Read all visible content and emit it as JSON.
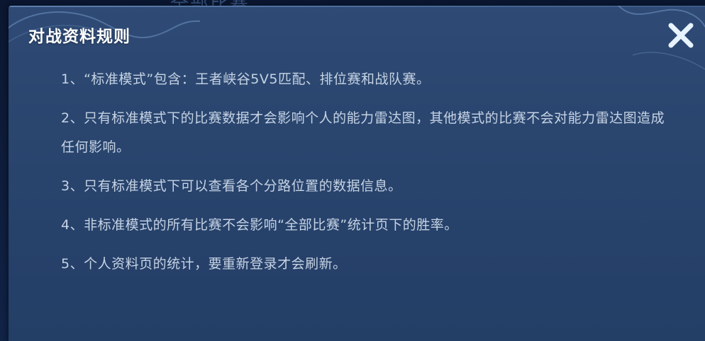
{
  "background": {
    "partial_text": "全部比赛"
  },
  "dialog": {
    "title": "对战资料规则",
    "close_icon": "close-x-icon",
    "rules": [
      "1、“标准模式”包含：王者峡谷5V5匹配、排位赛和战队赛。",
      "2、只有标准模式下的比赛数据才会影响个人的能力雷达图，其他模式的比赛不会对能力雷达图造成任何影响。",
      "3、只有标准模式下可以查看各个分路位置的数据信息。",
      "4、非标准模式的所有比赛不会影响“全部比赛”统计页下的胜率。",
      "5、个人资料页的统计，要重新登录才会刷新。"
    ]
  },
  "colors": {
    "panel_top": "#2e4a75",
    "panel_bottom": "#243f66",
    "title_text": "#ffffff",
    "body_text": "#c6d3e4",
    "close_icon": "#e8f3ff"
  }
}
